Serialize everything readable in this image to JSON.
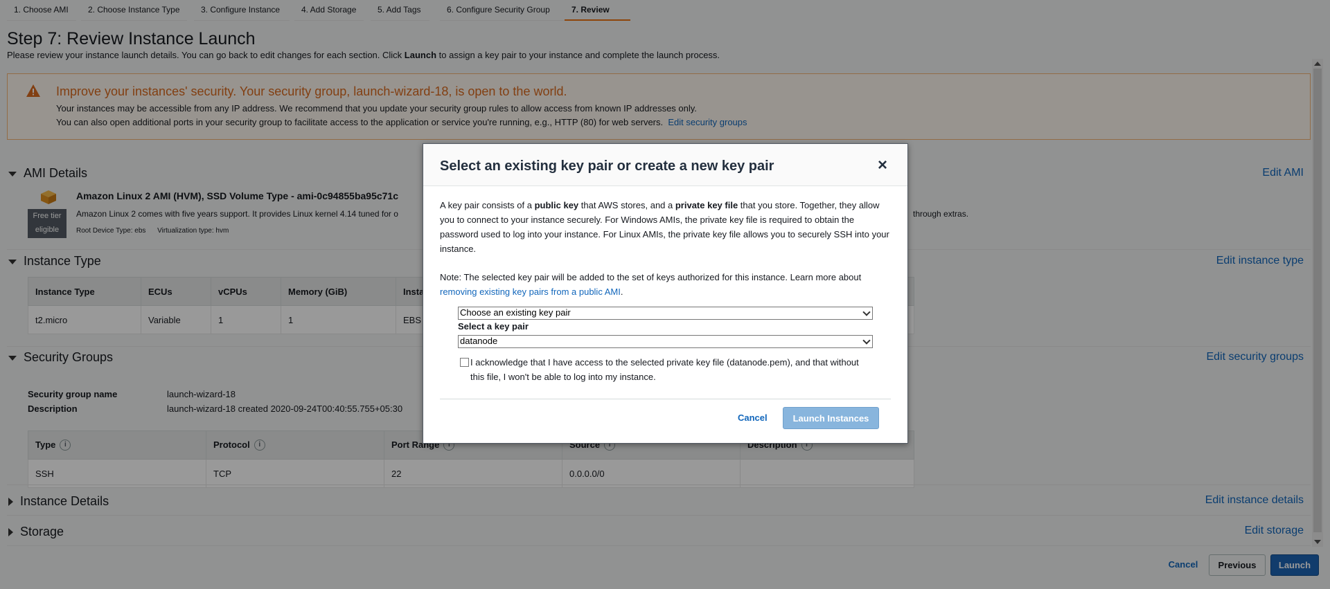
{
  "tabs": [
    {
      "label": "1. Choose AMI"
    },
    {
      "label": "2. Choose Instance Type"
    },
    {
      "label": "3. Configure Instance"
    },
    {
      "label": "4. Add Storage"
    },
    {
      "label": "5. Add Tags"
    },
    {
      "label": "6. Configure Security Group"
    },
    {
      "label": "7. Review"
    }
  ],
  "header": {
    "title": "Step 7: Review Instance Launch",
    "desc_before": "Please review your instance launch details. You can go back to edit changes for each section. Click ",
    "desc_bold": "Launch",
    "desc_after": " to assign a key pair to your instance and complete the launch process."
  },
  "warning": {
    "title": "Improve your instances' security. Your security group, launch-wizard-18, is open to the world.",
    "line1": "Your instances may be accessible from any IP address. We recommend that you update your security group rules to allow access from known IP addresses only.",
    "line2": "You can also open additional ports in your security group to facilitate access to the application or service you're running, e.g., HTTP (80) for web servers.",
    "link": "Edit security groups"
  },
  "ami": {
    "section": "AMI Details",
    "edit": "Edit AMI",
    "name": "Amazon Linux 2 AMI (HVM), SSD Volume Type - ami-0c94855ba95c71c",
    "badge_line1": "Free tier",
    "badge_line2": "eligible",
    "desc": "Amazon Linux 2 comes with five years support. It provides Linux kernel 4.14 tuned for o",
    "desc_right": "through extras.",
    "root_device": "Root Device Type: ebs",
    "virtualization": "Virtualization type: hvm"
  },
  "instance_type": {
    "section": "Instance Type",
    "edit": "Edit instance type",
    "headers": [
      "Instance Type",
      "ECUs",
      "vCPUs",
      "Memory (GiB)",
      "Insta"
    ],
    "row": [
      "t2.micro",
      "Variable",
      "1",
      "1",
      "EBS"
    ]
  },
  "security_groups": {
    "section": "Security Groups",
    "edit": "Edit security groups",
    "name_label": "Security group name",
    "name_value": "launch-wizard-18",
    "desc_label": "Description",
    "desc_value": "launch-wizard-18 created 2020-09-24T00:40:55.755+05:30",
    "headers": [
      "Type",
      "Protocol",
      "Port Range",
      "Source",
      "Description"
    ],
    "row": [
      "SSH",
      "TCP",
      "22",
      "0.0.0.0/0",
      ""
    ]
  },
  "instance_details": {
    "section": "Instance Details",
    "edit": "Edit instance details"
  },
  "storage": {
    "section": "Storage",
    "edit": "Edit storage"
  },
  "footer": {
    "cancel": "Cancel",
    "previous": "Previous",
    "launch": "Launch"
  },
  "modal": {
    "title": "Select an existing key pair or create a new key pair",
    "close": "×",
    "p1_a": "A key pair consists of a ",
    "p1_b": "public key",
    "p1_c": " that AWS stores, and a ",
    "p1_d": "private key file",
    "p1_e": " that you store. Together, they allow you to connect to your instance securely. For Windows AMIs, the private key file is required to obtain the password used to log into your instance. For Linux AMIs, the private key file allows you to securely SSH into your instance.",
    "note_a": "Note: The selected key pair will be added to the set of keys authorized for this instance. Learn more about ",
    "note_link": "removing existing key pairs from a public AMI",
    "note_b": ".",
    "select1_value": "Choose an existing key pair",
    "select_label": "Select a key pair",
    "select2_value": "datanode",
    "ack": "I acknowledge that I have access to the selected private key file (datanode.pem), and that without this file, I won't be able to log into my instance.",
    "cancel": "Cancel",
    "launch": "Launch Instances"
  },
  "colors": {
    "accent": "#ec7211",
    "link": "#1166bb",
    "primary": "#1d64b4",
    "warning": "#d9691e"
  }
}
